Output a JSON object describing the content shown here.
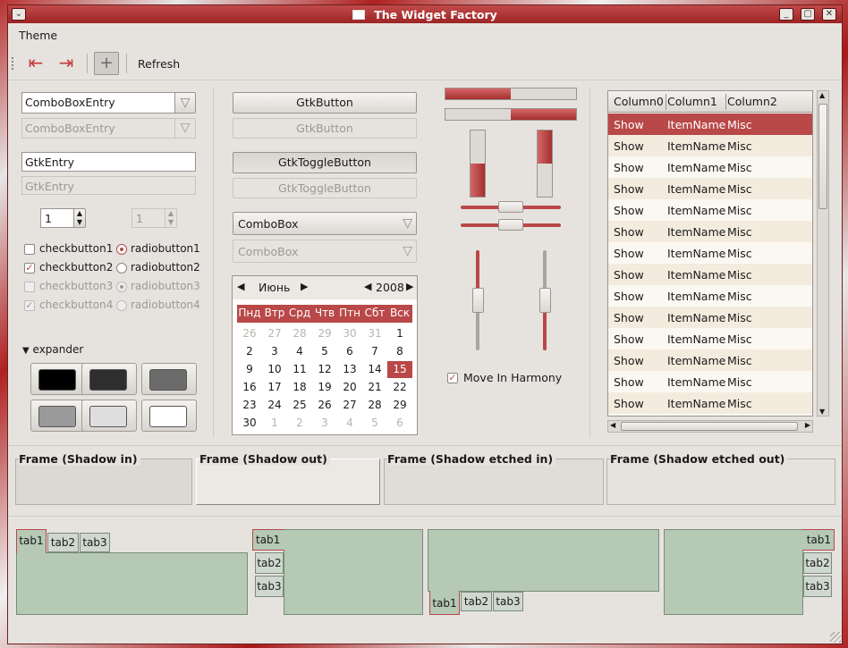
{
  "window": {
    "title": "The Widget Factory"
  },
  "menubar": {
    "items": [
      "Theme"
    ]
  },
  "toolbar": {
    "refresh_label": "Refresh"
  },
  "left": {
    "combo_entry_1": "ComboBoxEntry",
    "combo_entry_2": "ComboBoxEntry",
    "entry_1": "GtkEntry",
    "entry_2": "GtkEntry",
    "spin_1": "1",
    "spin_2": "1",
    "checks": [
      "checkbutton1",
      "checkbutton2",
      "checkbutton3",
      "checkbutton4"
    ],
    "radios": [
      "radiobutton1",
      "radiobutton2",
      "radiobutton3",
      "radiobutton4"
    ],
    "expander_label": "expander",
    "swatch_colors": [
      "#000000",
      "#2e2e2e",
      "#6b6b6b",
      "#9a9a9a",
      "#dedede",
      "#ffffff"
    ]
  },
  "middle": {
    "button_1": "GtkButton",
    "button_2": "GtkButton",
    "toggle_1": "GtkToggleButton",
    "toggle_2": "GtkToggleButton",
    "combo_1": "ComboBox",
    "combo_2": "ComboBox",
    "calendar": {
      "month": "Июнь",
      "year": "2008",
      "weekdays": [
        "Пнд",
        "Втр",
        "Срд",
        "Чтв",
        "Птн",
        "Сбт",
        "Вск"
      ],
      "weeks": [
        [
          "26",
          "27",
          "28",
          "29",
          "30",
          "31",
          "1"
        ],
        [
          "2",
          "3",
          "4",
          "5",
          "6",
          "7",
          "8"
        ],
        [
          "9",
          "10",
          "11",
          "12",
          "13",
          "14",
          "15"
        ],
        [
          "16",
          "17",
          "18",
          "19",
          "20",
          "21",
          "22"
        ],
        [
          "23",
          "24",
          "25",
          "26",
          "27",
          "28",
          "29"
        ],
        [
          "30",
          "1",
          "2",
          "3",
          "4",
          "5",
          "6"
        ]
      ],
      "selected_day": "15"
    }
  },
  "sliders": {
    "progress_top": 0.5,
    "progress_bottom": 0.5,
    "harmony_label": "Move In Harmony"
  },
  "treeview": {
    "columns": [
      "Column0",
      "Column1",
      "Column2"
    ],
    "rows": [
      [
        "Show",
        "ItemName",
        "Misc"
      ],
      [
        "Show",
        "ItemName",
        "Misc"
      ],
      [
        "Show",
        "ItemName",
        "Misc"
      ],
      [
        "Show",
        "ItemName",
        "Misc"
      ],
      [
        "Show",
        "ItemName",
        "Misc"
      ],
      [
        "Show",
        "ItemName",
        "Misc"
      ],
      [
        "Show",
        "ItemName",
        "Misc"
      ],
      [
        "Show",
        "ItemName",
        "Misc"
      ],
      [
        "Show",
        "ItemName",
        "Misc"
      ],
      [
        "Show",
        "ItemName",
        "Misc"
      ],
      [
        "Show",
        "ItemName",
        "Misc"
      ],
      [
        "Show",
        "ItemName",
        "Misc"
      ],
      [
        "Show",
        "ItemName",
        "Misc"
      ],
      [
        "Show",
        "ItemName",
        "Misc"
      ]
    ]
  },
  "frames": [
    "Frame (Shadow in)",
    "Frame (Shadow out)",
    "Frame (Shadow etched in)",
    "Frame (Shadow etched out)"
  ],
  "notebooks": {
    "tabs": [
      "tab1",
      "tab2",
      "tab3"
    ]
  },
  "colors": {
    "accent": "#b94848",
    "title_gradient_top": "#c24a4a",
    "title_gradient_bottom": "#9c2424",
    "notebook_page": "#b5c9b5"
  }
}
